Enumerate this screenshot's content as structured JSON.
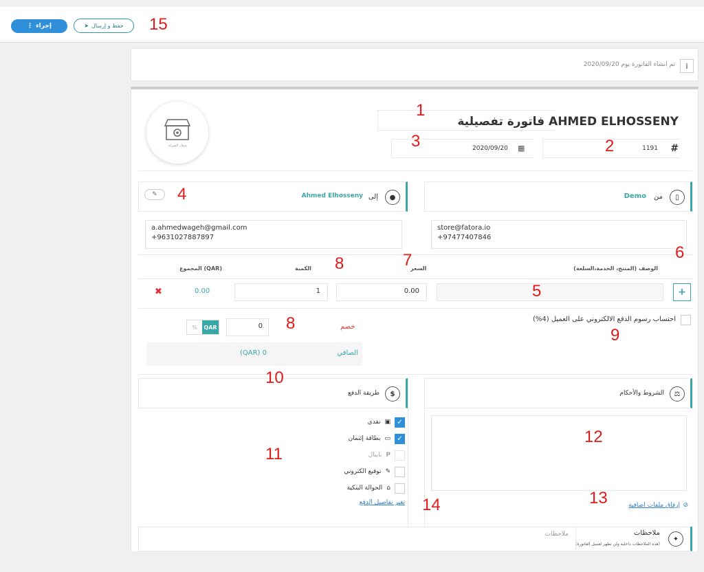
{
  "toolbar": {
    "action_label": "إجراء",
    "action_icon": "more-vertical-icon",
    "save_label": "حفظ و إرسال",
    "save_icon": "send-icon"
  },
  "annotations": [
    "1",
    "2",
    "3",
    "4",
    "5",
    "6",
    "7",
    "8",
    "8",
    "9",
    "10",
    "11",
    "12",
    "13",
    "14",
    "15"
  ],
  "info": {
    "text": "تم انشاء الفاتورة يوم 2020/09/20",
    "icon": "info-icon"
  },
  "invoice": {
    "title": "فاتورة تفصيلية AHMED ELHOSSENY",
    "hash": "#",
    "number": "1191",
    "date": "2020/09/20",
    "logo_caption": "شعار الشركة"
  },
  "from": {
    "label": "من",
    "name": "Demo",
    "email": "store@fatora.io",
    "phone": "+97477407846"
  },
  "to": {
    "label": "إلى",
    "name": "Ahmed Elhosseny",
    "email": "a.ahmedwageh@gmail.com",
    "phone": "+9631027887897"
  },
  "items_table": {
    "headers": {
      "description": "الوصف (المنتج، الخدمة،السلعة)",
      "price": "السعر",
      "quantity": "الكمية",
      "total": "المجموع (QAR)"
    },
    "row": {
      "description": "",
      "price": "0.00",
      "quantity": "1",
      "total": "0.00"
    },
    "add_label": "+",
    "delete_label": "✖"
  },
  "discount": {
    "label": "خصم",
    "value": "0",
    "currency_option": "QAR",
    "percent_option": "%"
  },
  "net": {
    "label": "الصافي",
    "value": "(QAR) 0"
  },
  "payment_fee": {
    "label": "احتساب رسوم الدفع الالكتروني على العميل (4%)"
  },
  "payment": {
    "title": "طريقة الدفع",
    "methods": [
      {
        "label": "نقدي",
        "checked": true,
        "icon": "cash-icon"
      },
      {
        "label": "بطاقة إئتمان",
        "checked": true,
        "icon": "credit-card-icon"
      },
      {
        "label": "بايبال",
        "checked": false,
        "icon": "paypal-icon"
      },
      {
        "label": "توقيع الكتروني",
        "checked": false,
        "icon": "pen-icon"
      },
      {
        "label": "الحوالة البنكية",
        "checked": false,
        "icon": "bank-icon"
      }
    ],
    "change_link": "تغير تفاصيل الدفع"
  },
  "terms": {
    "title": "الشروط والأحكام",
    "attach_link": "إرفاق ملفات اضافية"
  },
  "notes": {
    "title": "ملاحظات",
    "subtitle": "(هذه الملاحظات داخلية ولن تظهر لعميل الفاتورة)",
    "placeholder": "ملاحظات"
  },
  "colors": {
    "accent": "#3aa7a7",
    "primary": "#2f8fd8",
    "annotation": "#e01b1b",
    "danger": "#e0303a"
  }
}
